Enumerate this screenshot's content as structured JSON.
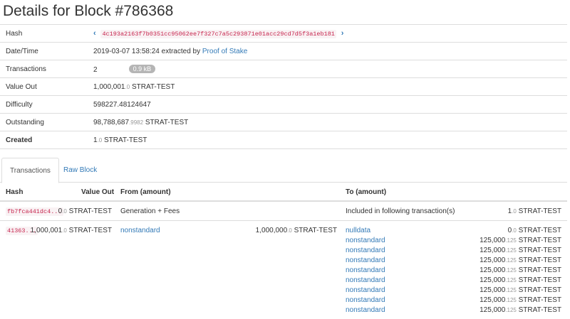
{
  "page_title": "Details for Block #786368",
  "details": {
    "hash_label": "Hash",
    "hash_value": "4c193a2163f7b0351cc95062ee7f327c7a5c293871e01acc29cd7d5f3a1eb181",
    "datetime_label": "Date/Time",
    "datetime_value": "2019-03-07 13:58:24 extracted by",
    "datetime_link": "Proof of Stake",
    "transactions_label": "Transactions",
    "transactions_value": "2",
    "transactions_size": "0.9 kB",
    "value_out_label": "Value Out",
    "value_out_int": "1,000,001",
    "value_out_dec": ".0",
    "value_out_unit": " STRAT-TEST",
    "difficulty_label": "Difficulty",
    "difficulty_value": "598227.48124647",
    "outstanding_label": "Outstanding",
    "outstanding_int": "98,788,687",
    "outstanding_dec": ".9982",
    "outstanding_unit": " STRAT-TEST",
    "created_label": "Created",
    "created_int": "1",
    "created_dec": ".0",
    "created_unit": " STRAT-TEST"
  },
  "tabs": {
    "transactions": "Transactions",
    "raw_block": "Raw Block"
  },
  "table": {
    "headers": {
      "hash": "Hash",
      "value_out": "Value Out",
      "from": "From (amount)",
      "to": "To (amount)"
    },
    "tx1": {
      "hash": "fb7fca441dc4...",
      "value_int": "0",
      "value_dec": ".0",
      "value_unit": " STRAT-TEST",
      "from": "Generation + Fees",
      "to": "Included in following transaction(s)",
      "to_int": "1",
      "to_dec": ".0",
      "to_unit": " STRAT-TEST"
    },
    "tx2": {
      "hash": "41363...",
      "value_int": "1,000,001",
      "value_dec": ".0",
      "value_unit": " STRAT-TEST",
      "from": "nonstandard",
      "from_int": "1,000,000",
      "from_dec": ".0",
      "from_unit": " STRAT-TEST",
      "outputs": [
        {
          "addr": "nulldata",
          "int": "0",
          "dec": ".0",
          "unit": " STRAT-TEST"
        },
        {
          "addr": "nonstandard",
          "int": "125,000",
          "dec": ".125",
          "unit": " STRAT-TEST"
        },
        {
          "addr": "nonstandard",
          "int": "125,000",
          "dec": ".125",
          "unit": " STRAT-TEST"
        },
        {
          "addr": "nonstandard",
          "int": "125,000",
          "dec": ".125",
          "unit": " STRAT-TEST"
        },
        {
          "addr": "nonstandard",
          "int": "125,000",
          "dec": ".125",
          "unit": " STRAT-TEST"
        },
        {
          "addr": "nonstandard",
          "int": "125,000",
          "dec": ".125",
          "unit": " STRAT-TEST"
        },
        {
          "addr": "nonstandard",
          "int": "125,000",
          "dec": ".125",
          "unit": " STRAT-TEST"
        },
        {
          "addr": "nonstandard",
          "int": "125,000",
          "dec": ".125",
          "unit": " STRAT-TEST"
        },
        {
          "addr": "nonstandard",
          "int": "125,000",
          "dec": ".125",
          "unit": " STRAT-TEST"
        }
      ]
    }
  },
  "icons": {
    "prev": "chevron-left-icon",
    "next": "chevron-right-icon"
  },
  "colors": {
    "link": "#337ab7",
    "hash_text": "#c7254e",
    "hash_bg": "#f9f2f4",
    "badge": "#b5b5b5"
  }
}
